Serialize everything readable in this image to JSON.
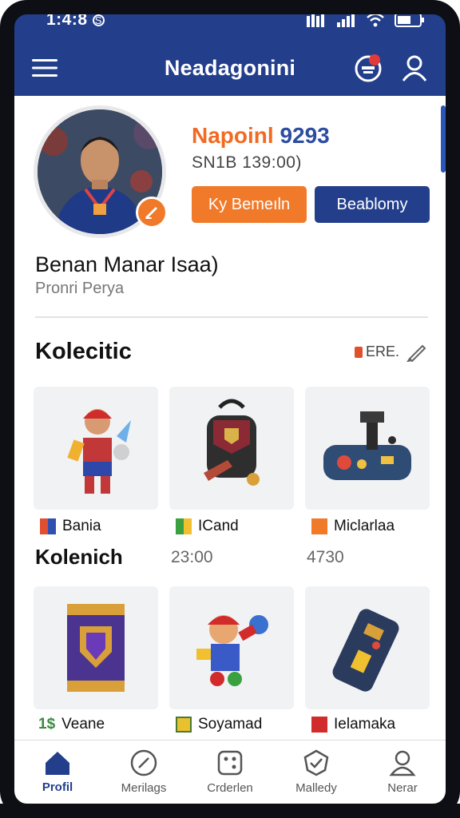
{
  "status": {
    "time": "1:4:8",
    "indicator": "S"
  },
  "app_bar": {
    "title": "Neadagonini"
  },
  "profile": {
    "name_part1": "Napoinl",
    "name_part2": "9293",
    "subtitle": "SN1B  139:00)",
    "primary_button": "Ky Bemeıln",
    "secondary_button": "Beablomy",
    "user_title": "Benan Manar Isaa)",
    "user_subtitle": "Pronri Perya"
  },
  "collection": {
    "title": "Kolecitic",
    "action_label": "ERE.",
    "items_row1": [
      {
        "label": "Bania",
        "icon": "flag-red-blue-icon"
      },
      {
        "label": "ICand",
        "icon": "flag-green-yellow-icon"
      },
      {
        "label": "Miclarlaa",
        "icon": "flag-orange-icon"
      }
    ],
    "row2_title": "Kolenich",
    "row2_meta": [
      "23:00",
      "4730"
    ],
    "items_row2": [
      {
        "label": "Veane",
        "prefix": "1$"
      },
      {
        "label": "Soyamad",
        "icon": "flag-yellow-icon"
      },
      {
        "label": "Ielamaka",
        "icon": "flag-red-icon"
      }
    ]
  },
  "nav": [
    {
      "label": "Profil",
      "icon": "home-icon",
      "active": true
    },
    {
      "label": "Merilags",
      "icon": "compass-icon"
    },
    {
      "label": "Crderlen",
      "icon": "dice-icon"
    },
    {
      "label": "Malledy",
      "icon": "shield-check-icon"
    },
    {
      "label": "Nerar",
      "icon": "user-icon"
    }
  ],
  "colors": {
    "primary": "#233f8c",
    "accent": "#f07a2a"
  }
}
